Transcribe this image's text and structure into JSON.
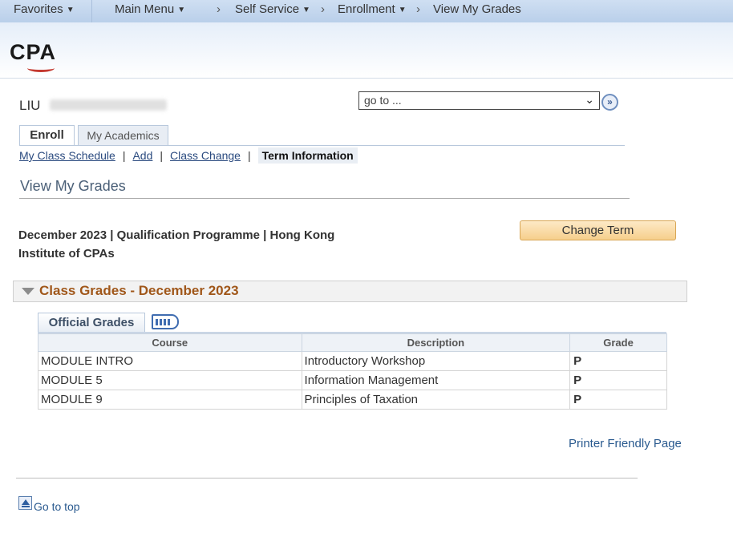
{
  "topnav": {
    "favorites": "Favorites",
    "main_menu": "Main Menu",
    "breadcrumb": [
      "Self Service",
      "Enrollment",
      "View My Grades"
    ]
  },
  "header": {
    "logo": "CPA"
  },
  "student": {
    "name": "LIU"
  },
  "goto": {
    "value": "go to ..."
  },
  "tabs": [
    {
      "label": "Enroll",
      "active": true
    },
    {
      "label": "My Academics",
      "active": false
    }
  ],
  "subnav": [
    {
      "label": "My Class Schedule"
    },
    {
      "label": "Add"
    },
    {
      "label": "Class Change"
    },
    {
      "label": "Term Information",
      "current": true
    }
  ],
  "page_title": "View My Grades",
  "term_info": "December 2023 | Qualification Programme | Hong Kong Institute of CPAs",
  "change_term_label": "Change Term",
  "section_title": "Class Grades - December 2023",
  "grid_tab_label": "Official Grades",
  "table": {
    "columns": [
      "Course",
      "Description",
      "Grade"
    ],
    "rows": [
      [
        "MODULE INTRO",
        "Introductory Workshop",
        "P"
      ],
      [
        "MODULE 5",
        "Information Management",
        "P"
      ],
      [
        "MODULE 9",
        "Principles of Taxation",
        "P"
      ]
    ]
  },
  "printer_friendly": "Printer Friendly Page",
  "go_to_top": "Go to top",
  "colors": {
    "accent_link": "#2a5a8f",
    "section_title": "#a0571a",
    "button_orange": "#f6cf8c",
    "nav_bg": "#b9cfea"
  },
  "icons": {
    "goto": "double-chevron-right-icon",
    "section_toggle": "triangle-down-icon",
    "grid_view": "grid-view-icon",
    "go_to_top": "arrow-up-to-top-icon"
  }
}
